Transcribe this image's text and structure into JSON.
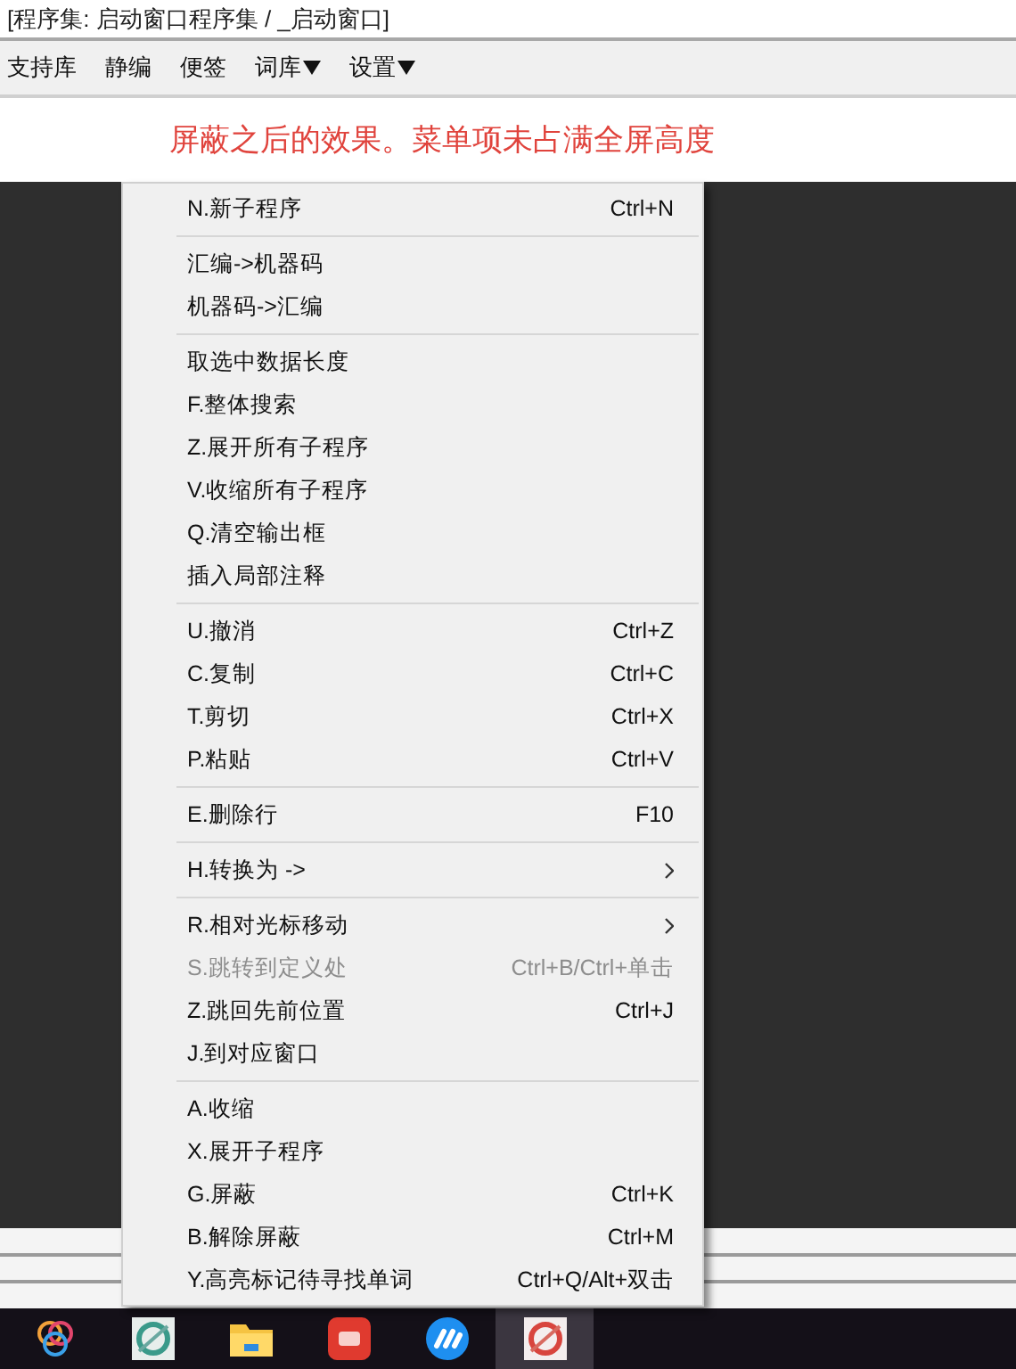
{
  "window": {
    "title": "[程序集: 启动窗口程序集 / _启动窗口]"
  },
  "toolbar": [
    {
      "label": "支持库",
      "dropdown": false
    },
    {
      "label": "静编",
      "dropdown": false
    },
    {
      "label": "便签",
      "dropdown": false
    },
    {
      "label": "词库",
      "dropdown": true
    },
    {
      "label": "设置",
      "dropdown": true
    }
  ],
  "annotation": "屏蔽之后的效果。菜单项未占满全屏高度",
  "context_menu": {
    "sections": [
      {
        "items": [
          {
            "label": "N.新子程序",
            "shortcut": "Ctrl+N",
            "submenu": false,
            "disabled": false
          }
        ]
      },
      {
        "items": [
          {
            "label": "汇编->机器码",
            "submenu": false,
            "disabled": false
          },
          {
            "label": "机器码->汇编",
            "submenu": false,
            "disabled": false
          }
        ]
      },
      {
        "items": [
          {
            "label": "取选中数据长度",
            "submenu": false,
            "disabled": false
          },
          {
            "label": "F.整体搜索",
            "submenu": false,
            "disabled": false
          },
          {
            "label": "Z.展开所有子程序",
            "submenu": false,
            "disabled": false
          },
          {
            "label": "V.收缩所有子程序",
            "submenu": false,
            "disabled": false
          },
          {
            "label": "Q.清空输出框",
            "submenu": false,
            "disabled": false
          },
          {
            "label": "插入局部注释",
            "submenu": false,
            "disabled": false
          }
        ]
      },
      {
        "items": [
          {
            "label": "U.撤消",
            "shortcut": "Ctrl+Z",
            "submenu": false,
            "disabled": false
          },
          {
            "label": "C.复制",
            "shortcut": "Ctrl+C",
            "submenu": false,
            "disabled": false
          },
          {
            "label": "T.剪切",
            "shortcut": "Ctrl+X",
            "submenu": false,
            "disabled": false
          },
          {
            "label": "P.粘贴",
            "shortcut": "Ctrl+V",
            "submenu": false,
            "disabled": false
          }
        ]
      },
      {
        "items": [
          {
            "label": "E.删除行",
            "shortcut": "F10",
            "submenu": false,
            "disabled": false
          }
        ]
      },
      {
        "items": [
          {
            "label": "H.转换为 ->",
            "submenu": true,
            "disabled": false
          }
        ]
      },
      {
        "items": [
          {
            "label": "R.相对光标移动",
            "submenu": true,
            "disabled": false
          },
          {
            "label": "S.跳转到定义处",
            "shortcut": "Ctrl+B/Ctrl+单击",
            "submenu": false,
            "disabled": true
          },
          {
            "label": "Z.跳回先前位置",
            "shortcut": "Ctrl+J",
            "submenu": false,
            "disabled": false
          },
          {
            "label": "J.到对应窗口",
            "submenu": false,
            "disabled": false
          }
        ]
      },
      {
        "items": [
          {
            "label": "A.收缩",
            "submenu": false,
            "disabled": false
          },
          {
            "label": "X.展开子程序",
            "submenu": false,
            "disabled": false
          },
          {
            "label": "G.屏蔽",
            "shortcut": "Ctrl+K",
            "submenu": false,
            "disabled": false
          },
          {
            "label": "B.解除屏蔽",
            "shortcut": "Ctrl+M",
            "submenu": false,
            "disabled": false
          },
          {
            "label": "Y.高亮标记待寻找单词",
            "shortcut": "Ctrl+Q/Alt+双击",
            "submenu": false,
            "disabled": false
          }
        ]
      }
    ]
  },
  "taskbar": [
    {
      "kind": "rings",
      "selected": false
    },
    {
      "kind": "app-green",
      "selected": false
    },
    {
      "kind": "folder",
      "selected": false
    },
    {
      "kind": "app-red",
      "selected": false
    },
    {
      "kind": "app-blue",
      "selected": false
    },
    {
      "kind": "app-red-white",
      "selected": true
    }
  ]
}
